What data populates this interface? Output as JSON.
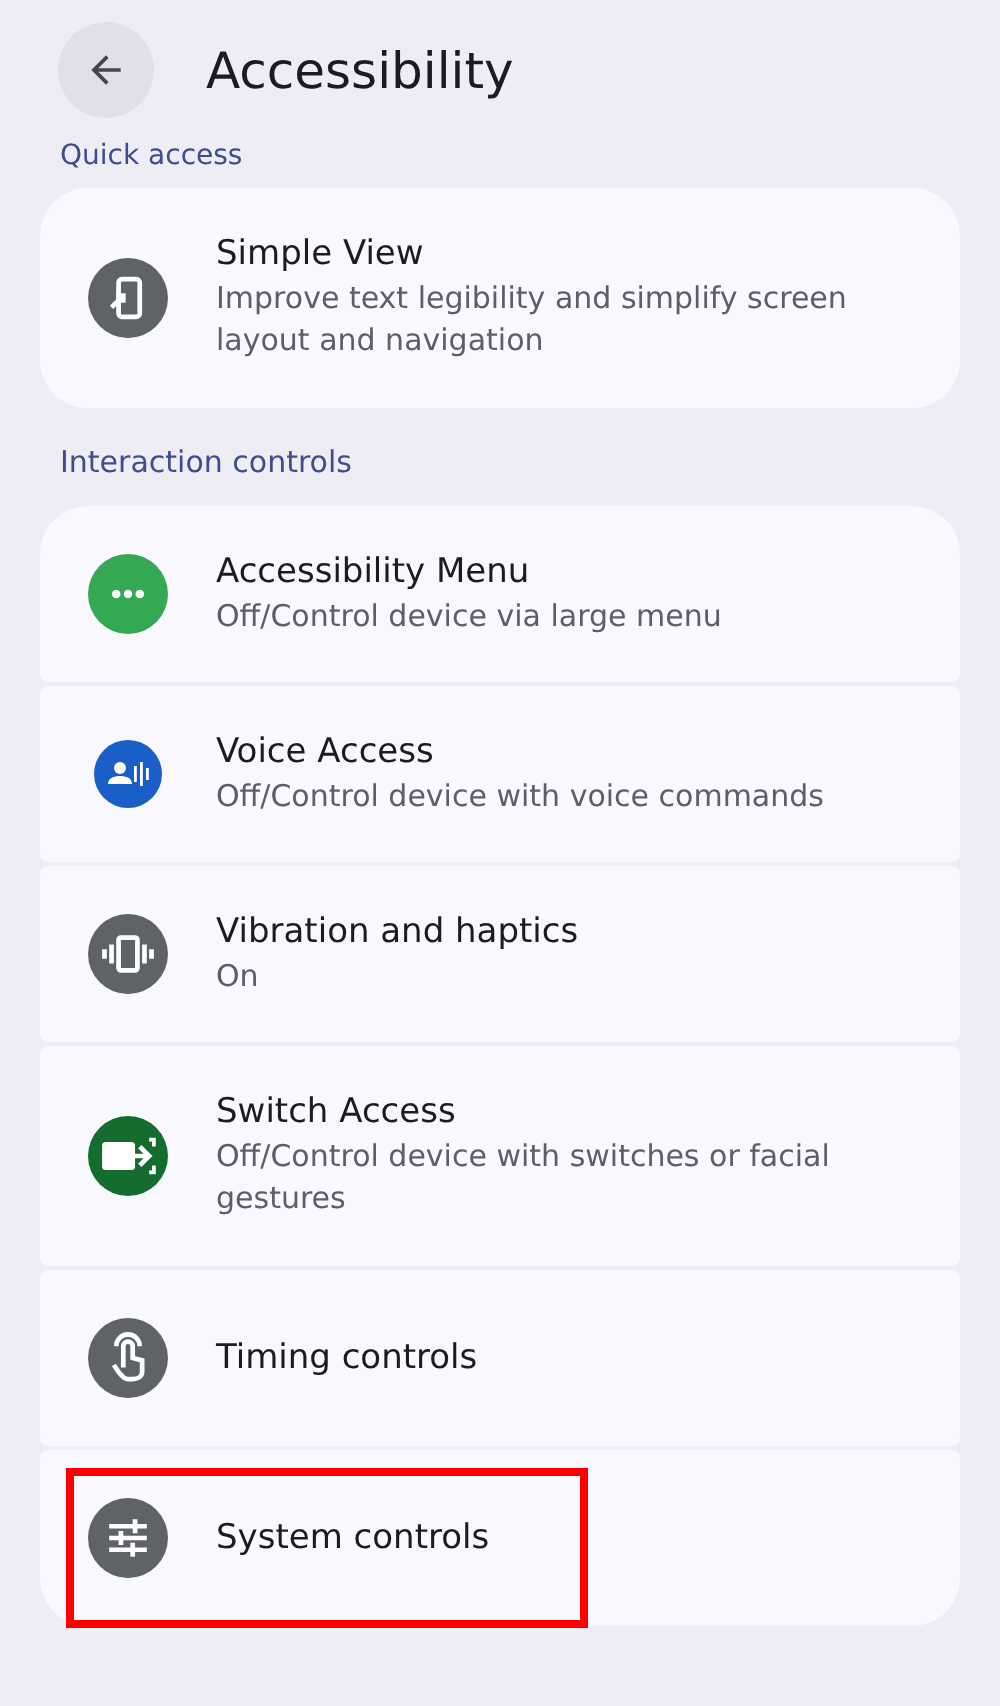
{
  "header": {
    "title": "Accessibility"
  },
  "sections": [
    {
      "label": "Quick access",
      "items": [
        {
          "kind": "simple",
          "color": "#5f6368",
          "title": "Simple View",
          "subtitle": "Improve text legibility and simplify screen layout and navigation",
          "highlighted": false
        }
      ]
    },
    {
      "label": "Interaction controls",
      "items": [
        {
          "kind": "menu",
          "color": "#34a853",
          "title": "Accessibility Menu",
          "subtitle": "Off/Control device via large menu",
          "highlighted": false
        },
        {
          "kind": "voice",
          "color": "#1a5fc8",
          "title": "Voice Access",
          "subtitle": "Off/Control device with voice commands",
          "highlighted": false
        },
        {
          "kind": "vibration",
          "color": "#5f6368",
          "title": "Vibration and haptics",
          "subtitle": "On",
          "highlighted": false
        },
        {
          "kind": "switch",
          "color": "#146c2e",
          "title": "Switch Access",
          "subtitle": "Off/Control device with switches or facial gestures",
          "highlighted": false
        },
        {
          "kind": "touch",
          "color": "#5f6368",
          "title": "Timing controls",
          "highlighted": false
        },
        {
          "kind": "sliders",
          "color": "#5f6368",
          "title": "System controls",
          "highlighted": true
        }
      ]
    }
  ]
}
